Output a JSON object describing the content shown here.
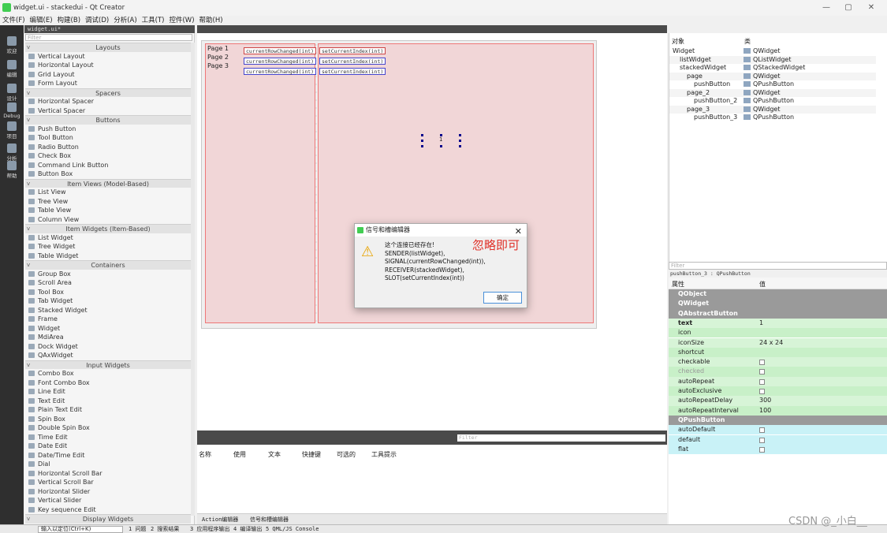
{
  "window": {
    "title": "widget.ui - stackedui - Qt Creator",
    "controls": [
      "—",
      "▢",
      "✕"
    ]
  },
  "menu": [
    "文件(F)",
    "编辑(E)",
    "构建(B)",
    "调试(D)",
    "分析(A)",
    "工具(T)",
    "控件(W)",
    "帮助(H)"
  ],
  "modes": [
    "欢迎",
    "编辑",
    "设计",
    "Debug",
    "项目",
    "分析",
    "帮助"
  ],
  "editor_tab": "widget.ui*",
  "widgetbox": {
    "filter_placeholder": "Filter",
    "sections": [
      {
        "title": "Layouts",
        "items": [
          "Vertical Layout",
          "Horizontal Layout",
          "Grid Layout",
          "Form Layout"
        ]
      },
      {
        "title": "Spacers",
        "items": [
          "Horizontal Spacer",
          "Vertical Spacer"
        ]
      },
      {
        "title": "Buttons",
        "items": [
          "Push Button",
          "Tool Button",
          "Radio Button",
          "Check Box",
          "Command Link Button",
          "Button Box"
        ]
      },
      {
        "title": "Item Views (Model-Based)",
        "items": [
          "List View",
          "Tree View",
          "Table View",
          "Column View"
        ]
      },
      {
        "title": "Item Widgets (Item-Based)",
        "items": [
          "List Widget",
          "Tree Widget",
          "Table Widget"
        ]
      },
      {
        "title": "Containers",
        "items": [
          "Group Box",
          "Scroll Area",
          "Tool Box",
          "Tab Widget",
          "Stacked Widget",
          "Frame",
          "Widget",
          "MdiArea",
          "Dock Widget",
          "QAxWidget"
        ]
      },
      {
        "title": "Input Widgets",
        "items": [
          "Combo Box",
          "Font Combo Box",
          "Line Edit",
          "Text Edit",
          "Plain Text Edit",
          "Spin Box",
          "Double Spin Box",
          "Time Edit",
          "Date Edit",
          "Date/Time Edit",
          "Dial",
          "Horizontal Scroll Bar",
          "Vertical Scroll Bar",
          "Horizontal Slider",
          "Vertical Slider",
          "Key sequence Edit"
        ]
      },
      {
        "title": "Display Widgets",
        "items": []
      }
    ]
  },
  "form": {
    "list_items": [
      "Page 1",
      "Page 2",
      "Page 3"
    ],
    "signal": "currentRowChanged(int)",
    "slot": "setCurrentIndex(int)",
    "button_text": "1"
  },
  "dialog": {
    "title": "信号和槽编辑器",
    "lines": [
      "这个连接已经存在!",
      "SENDER(listWidget),",
      "SIGNAL(currentRowChanged(int)),",
      "RECEIVER(stackedWidget),",
      "SLOT(setCurrentIndex(int))"
    ],
    "ok": "确定"
  },
  "annotation": "忽略即可",
  "action_editor": {
    "filter_placeholder": "Filter",
    "columns": [
      "名称",
      "使用",
      "文本",
      "快捷键",
      "可选的",
      "工具提示"
    ],
    "tabs": [
      "Action编辑器",
      "信号和槽编辑器"
    ]
  },
  "object_inspector": {
    "headers": [
      "对象",
      "类"
    ],
    "rows": [
      {
        "name": "Widget",
        "cls": "QWidget",
        "indent": 0
      },
      {
        "name": "listWidget",
        "cls": "QListWidget",
        "indent": 1
      },
      {
        "name": "stackedWidget",
        "cls": "QStackedWidget",
        "indent": 1
      },
      {
        "name": "page",
        "cls": "QWidget",
        "indent": 2
      },
      {
        "name": "pushButton",
        "cls": "QPushButton",
        "indent": 3
      },
      {
        "name": "page_2",
        "cls": "QWidget",
        "indent": 2
      },
      {
        "name": "pushButton_2",
        "cls": "QPushButton",
        "indent": 3
      },
      {
        "name": "page_3",
        "cls": "QWidget",
        "indent": 2
      },
      {
        "name": "pushButton_3",
        "cls": "QPushButton",
        "indent": 3
      }
    ]
  },
  "property_editor": {
    "filter_placeholder": "Filter",
    "selected": "pushButton_3 : QPushButton",
    "headers": [
      "属性",
      "值"
    ],
    "rows": [
      {
        "name": "QObject",
        "type": "section"
      },
      {
        "name": "QWidget",
        "type": "section"
      },
      {
        "name": "QAbstractButton",
        "type": "section-open"
      },
      {
        "name": "text",
        "value": "1",
        "style": "g",
        "bold": true
      },
      {
        "name": "icon",
        "value": "",
        "style": "g2"
      },
      {
        "name": "iconSize",
        "value": "24 x 24",
        "style": "g"
      },
      {
        "name": "shortcut",
        "value": "",
        "style": "g2"
      },
      {
        "name": "checkable",
        "check": false,
        "style": "g"
      },
      {
        "name": "checked",
        "check": false,
        "style": "g2",
        "dim": true
      },
      {
        "name": "autoRepeat",
        "check": false,
        "style": "g"
      },
      {
        "name": "autoExclusive",
        "check": false,
        "style": "g2"
      },
      {
        "name": "autoRepeatDelay",
        "value": "300",
        "style": "g"
      },
      {
        "name": "autoRepeatInterval",
        "value": "100",
        "style": "g2"
      },
      {
        "name": "QPushButton",
        "type": "section-open"
      },
      {
        "name": "autoDefault",
        "check": false,
        "style": "cy"
      },
      {
        "name": "default",
        "check": false,
        "style": "cy"
      },
      {
        "name": "flat",
        "check": false,
        "style": "cy"
      }
    ]
  },
  "statusbar": {
    "locator_placeholder": "输入以定位(Ctrl+K)",
    "tabs": [
      "1 问题",
      "2 搜索结果",
      "3 应用程序输出",
      "4 编译输出",
      "5 QML/JS Console"
    ]
  },
  "watermark": "CSDN @_小白__"
}
